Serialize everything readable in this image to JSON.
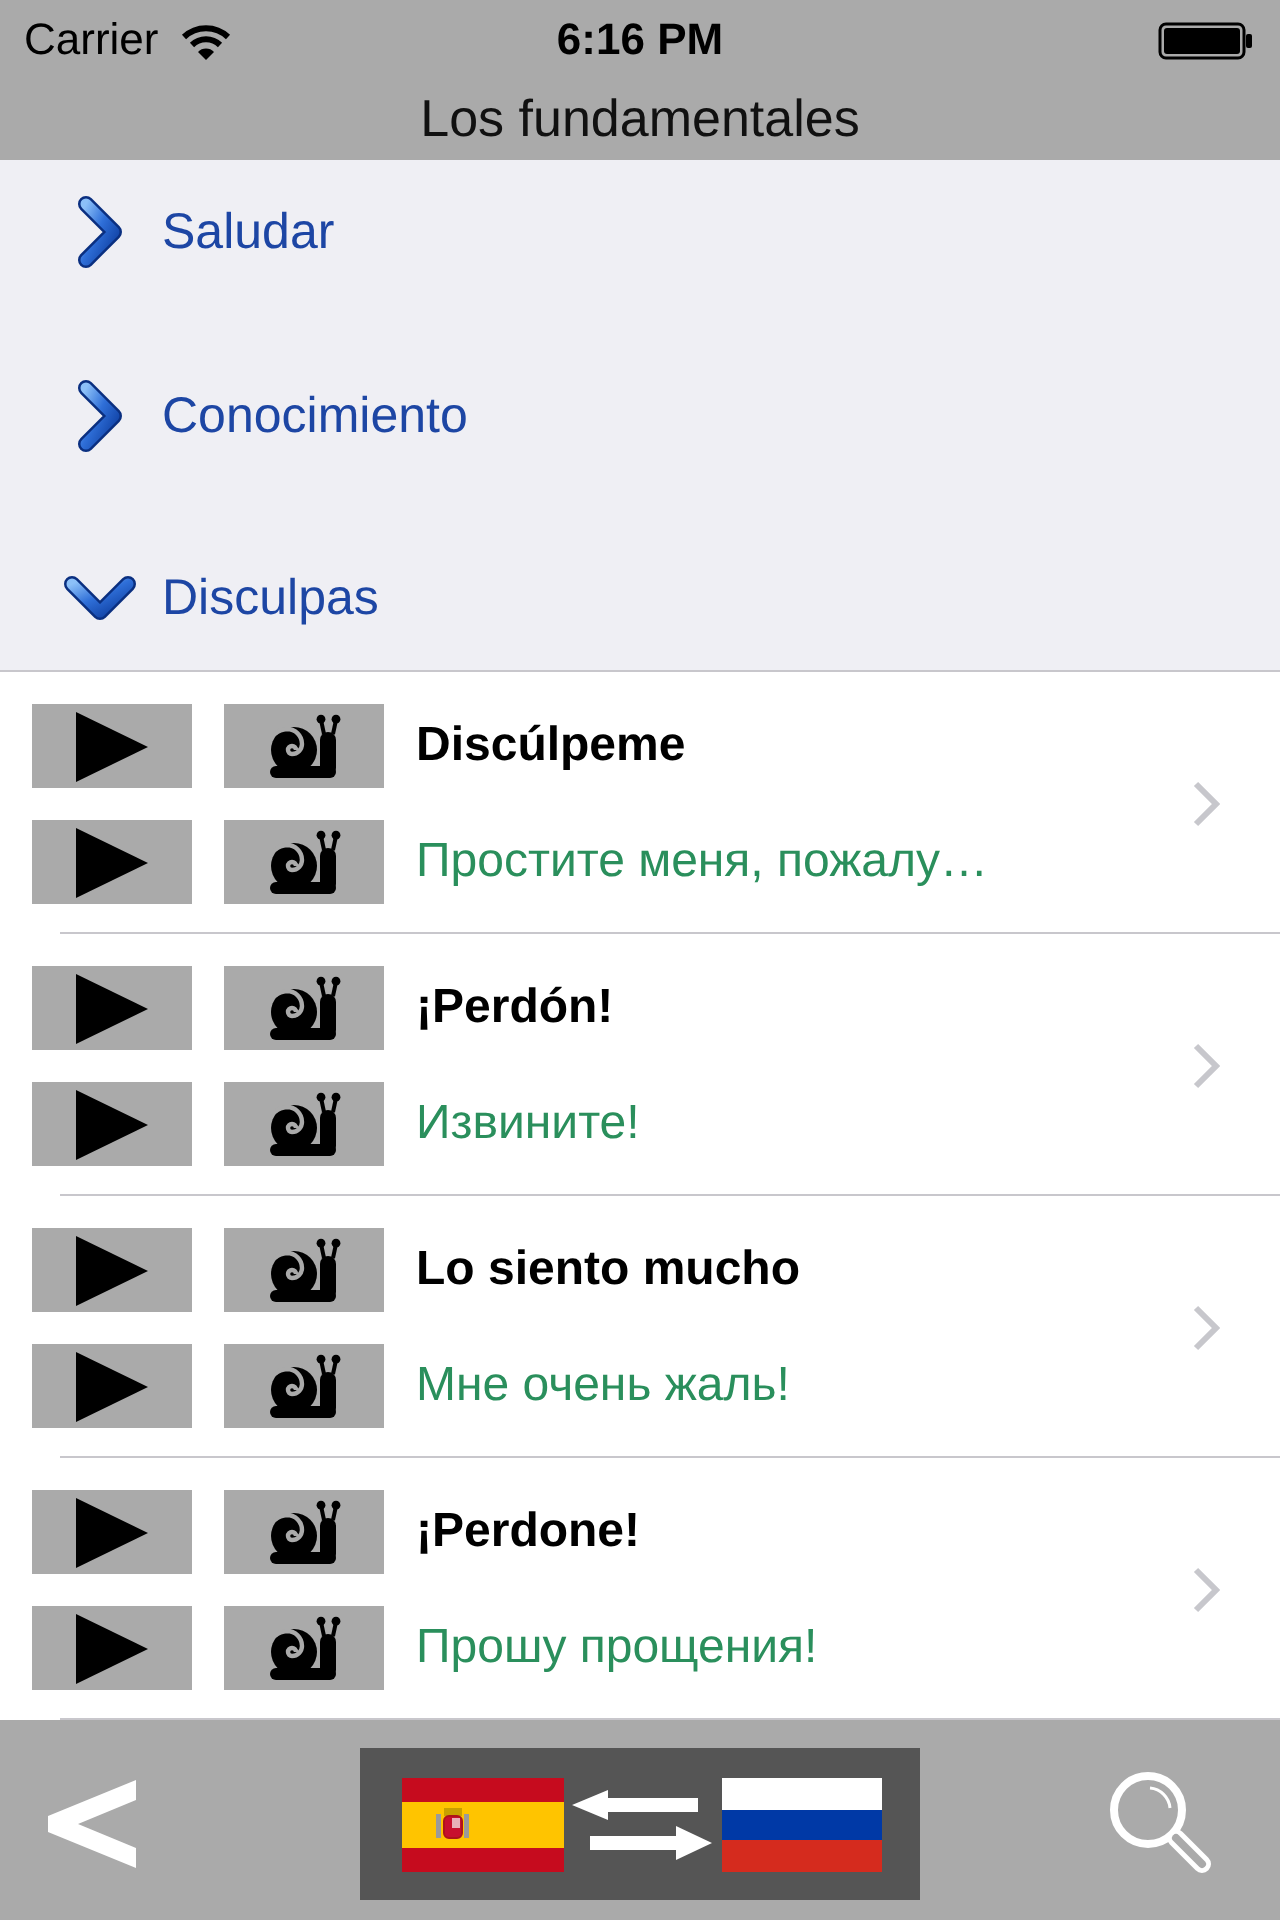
{
  "status_bar": {
    "carrier": "Carrier",
    "time": "6:16 PM"
  },
  "nav_bar": {
    "title": "Los fundamentales"
  },
  "sections": [
    {
      "label": "Saludar",
      "expanded": false
    },
    {
      "label": "Conocimiento",
      "expanded": false
    },
    {
      "label": "Disculpas",
      "expanded": true,
      "phrases": [
        {
          "source": "Discúlpeme",
          "translation": "Простите меня, пожалу…"
        },
        {
          "source": "¡Perdón!",
          "translation": "Извините!"
        },
        {
          "source": "Lo siento mucho",
          "translation": "Мне очень жаль!"
        },
        {
          "source": "¡Perdone!",
          "translation": "Прошу прощения!"
        }
      ]
    }
  ]
}
